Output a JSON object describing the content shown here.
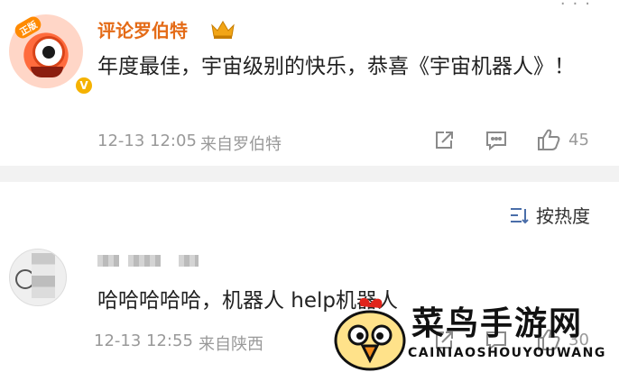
{
  "post": {
    "more": "···",
    "author": {
      "name": "评论罗伯特",
      "badge": "正版",
      "verified": "V"
    },
    "text": "年度最佳，宇宙级别的快乐，恭喜《宇宙机器人》！",
    "time": "12-13 12:05",
    "source": "来自罗伯特",
    "likes": "45"
  },
  "comments": {
    "sort_label": "按热度",
    "items": [
      {
        "text": "哈哈哈哈哈，机器人 help机器人",
        "time": "12-13 12:55",
        "source": "来自陕西",
        "likes": "30"
      }
    ]
  },
  "watermark": {
    "title": "菜鸟手游网",
    "subtitle": "CAINIAOSHOUYOUWANG"
  },
  "colors": {
    "username": "#e46b17",
    "accent_blue": "#4a6ea9",
    "meta_gray": "#999999"
  }
}
